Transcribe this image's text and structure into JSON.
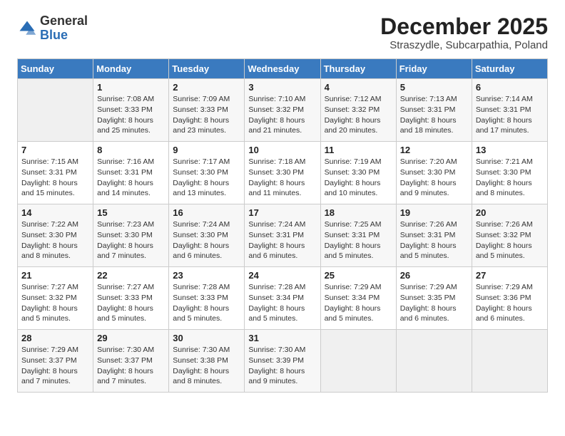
{
  "header": {
    "logo_general": "General",
    "logo_blue": "Blue",
    "month_title": "December 2025",
    "subtitle": "Straszydle, Subcarpathia, Poland"
  },
  "days_of_week": [
    "Sunday",
    "Monday",
    "Tuesday",
    "Wednesday",
    "Thursday",
    "Friday",
    "Saturday"
  ],
  "weeks": [
    [
      {
        "day": "",
        "lines": []
      },
      {
        "day": "1",
        "lines": [
          "Sunrise: 7:08 AM",
          "Sunset: 3:33 PM",
          "Daylight: 8 hours",
          "and 25 minutes."
        ]
      },
      {
        "day": "2",
        "lines": [
          "Sunrise: 7:09 AM",
          "Sunset: 3:33 PM",
          "Daylight: 8 hours",
          "and 23 minutes."
        ]
      },
      {
        "day": "3",
        "lines": [
          "Sunrise: 7:10 AM",
          "Sunset: 3:32 PM",
          "Daylight: 8 hours",
          "and 21 minutes."
        ]
      },
      {
        "day": "4",
        "lines": [
          "Sunrise: 7:12 AM",
          "Sunset: 3:32 PM",
          "Daylight: 8 hours",
          "and 20 minutes."
        ]
      },
      {
        "day": "5",
        "lines": [
          "Sunrise: 7:13 AM",
          "Sunset: 3:31 PM",
          "Daylight: 8 hours",
          "and 18 minutes."
        ]
      },
      {
        "day": "6",
        "lines": [
          "Sunrise: 7:14 AM",
          "Sunset: 3:31 PM",
          "Daylight: 8 hours",
          "and 17 minutes."
        ]
      }
    ],
    [
      {
        "day": "7",
        "lines": [
          "Sunrise: 7:15 AM",
          "Sunset: 3:31 PM",
          "Daylight: 8 hours",
          "and 15 minutes."
        ]
      },
      {
        "day": "8",
        "lines": [
          "Sunrise: 7:16 AM",
          "Sunset: 3:31 PM",
          "Daylight: 8 hours",
          "and 14 minutes."
        ]
      },
      {
        "day": "9",
        "lines": [
          "Sunrise: 7:17 AM",
          "Sunset: 3:30 PM",
          "Daylight: 8 hours",
          "and 13 minutes."
        ]
      },
      {
        "day": "10",
        "lines": [
          "Sunrise: 7:18 AM",
          "Sunset: 3:30 PM",
          "Daylight: 8 hours",
          "and 11 minutes."
        ]
      },
      {
        "day": "11",
        "lines": [
          "Sunrise: 7:19 AM",
          "Sunset: 3:30 PM",
          "Daylight: 8 hours",
          "and 10 minutes."
        ]
      },
      {
        "day": "12",
        "lines": [
          "Sunrise: 7:20 AM",
          "Sunset: 3:30 PM",
          "Daylight: 8 hours",
          "and 9 minutes."
        ]
      },
      {
        "day": "13",
        "lines": [
          "Sunrise: 7:21 AM",
          "Sunset: 3:30 PM",
          "Daylight: 8 hours",
          "and 8 minutes."
        ]
      }
    ],
    [
      {
        "day": "14",
        "lines": [
          "Sunrise: 7:22 AM",
          "Sunset: 3:30 PM",
          "Daylight: 8 hours",
          "and 8 minutes."
        ]
      },
      {
        "day": "15",
        "lines": [
          "Sunrise: 7:23 AM",
          "Sunset: 3:30 PM",
          "Daylight: 8 hours",
          "and 7 minutes."
        ]
      },
      {
        "day": "16",
        "lines": [
          "Sunrise: 7:24 AM",
          "Sunset: 3:30 PM",
          "Daylight: 8 hours",
          "and 6 minutes."
        ]
      },
      {
        "day": "17",
        "lines": [
          "Sunrise: 7:24 AM",
          "Sunset: 3:31 PM",
          "Daylight: 8 hours",
          "and 6 minutes."
        ]
      },
      {
        "day": "18",
        "lines": [
          "Sunrise: 7:25 AM",
          "Sunset: 3:31 PM",
          "Daylight: 8 hours",
          "and 5 minutes."
        ]
      },
      {
        "day": "19",
        "lines": [
          "Sunrise: 7:26 AM",
          "Sunset: 3:31 PM",
          "Daylight: 8 hours",
          "and 5 minutes."
        ]
      },
      {
        "day": "20",
        "lines": [
          "Sunrise: 7:26 AM",
          "Sunset: 3:32 PM",
          "Daylight: 8 hours",
          "and 5 minutes."
        ]
      }
    ],
    [
      {
        "day": "21",
        "lines": [
          "Sunrise: 7:27 AM",
          "Sunset: 3:32 PM",
          "Daylight: 8 hours",
          "and 5 minutes."
        ]
      },
      {
        "day": "22",
        "lines": [
          "Sunrise: 7:27 AM",
          "Sunset: 3:33 PM",
          "Daylight: 8 hours",
          "and 5 minutes."
        ]
      },
      {
        "day": "23",
        "lines": [
          "Sunrise: 7:28 AM",
          "Sunset: 3:33 PM",
          "Daylight: 8 hours",
          "and 5 minutes."
        ]
      },
      {
        "day": "24",
        "lines": [
          "Sunrise: 7:28 AM",
          "Sunset: 3:34 PM",
          "Daylight: 8 hours",
          "and 5 minutes."
        ]
      },
      {
        "day": "25",
        "lines": [
          "Sunrise: 7:29 AM",
          "Sunset: 3:34 PM",
          "Daylight: 8 hours",
          "and 5 minutes."
        ]
      },
      {
        "day": "26",
        "lines": [
          "Sunrise: 7:29 AM",
          "Sunset: 3:35 PM",
          "Daylight: 8 hours",
          "and 6 minutes."
        ]
      },
      {
        "day": "27",
        "lines": [
          "Sunrise: 7:29 AM",
          "Sunset: 3:36 PM",
          "Daylight: 8 hours",
          "and 6 minutes."
        ]
      }
    ],
    [
      {
        "day": "28",
        "lines": [
          "Sunrise: 7:29 AM",
          "Sunset: 3:37 PM",
          "Daylight: 8 hours",
          "and 7 minutes."
        ]
      },
      {
        "day": "29",
        "lines": [
          "Sunrise: 7:30 AM",
          "Sunset: 3:37 PM",
          "Daylight: 8 hours",
          "and 7 minutes."
        ]
      },
      {
        "day": "30",
        "lines": [
          "Sunrise: 7:30 AM",
          "Sunset: 3:38 PM",
          "Daylight: 8 hours",
          "and 8 minutes."
        ]
      },
      {
        "day": "31",
        "lines": [
          "Sunrise: 7:30 AM",
          "Sunset: 3:39 PM",
          "Daylight: 8 hours",
          "and 9 minutes."
        ]
      },
      {
        "day": "",
        "lines": []
      },
      {
        "day": "",
        "lines": []
      },
      {
        "day": "",
        "lines": []
      }
    ]
  ]
}
